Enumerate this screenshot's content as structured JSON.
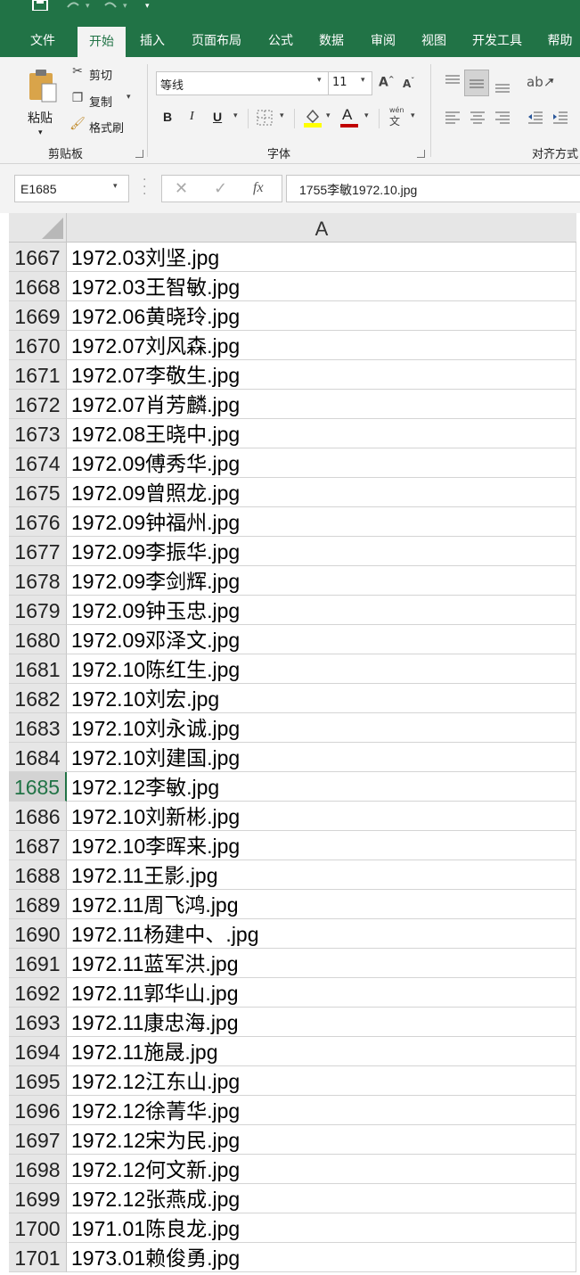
{
  "tabs": [
    "文件",
    "开始",
    "插入",
    "页面布局",
    "公式",
    "数据",
    "审阅",
    "视图",
    "开发工具",
    "帮助"
  ],
  "clipboard": {
    "paste": "粘贴",
    "cut": "剪切",
    "copy": "复制",
    "format_painter": "格式刷",
    "group_label": "剪贴板"
  },
  "font": {
    "name": "等线",
    "size": "11",
    "bold": "B",
    "italic": "I",
    "underline": "U",
    "group_label": "字体",
    "phonetic_top": "wén",
    "phonetic_bottom": "文"
  },
  "alignment": {
    "group_label": "对齐方式"
  },
  "name_box": "E1685",
  "formula": "1755李敏1972.10.jpg",
  "fx": "fx",
  "column_header": "A",
  "selected_row": "1685",
  "rows": [
    {
      "num": "1667",
      "value": "1972.03刘坚.jpg"
    },
    {
      "num": "1668",
      "value": "1972.03王智敏.jpg"
    },
    {
      "num": "1669",
      "value": "1972.06黄晓玲.jpg"
    },
    {
      "num": "1670",
      "value": "1972.07刘风森.jpg"
    },
    {
      "num": "1671",
      "value": "1972.07李敬生.jpg"
    },
    {
      "num": "1672",
      "value": "1972.07肖芳麟.jpg"
    },
    {
      "num": "1673",
      "value": "1972.08王晓中.jpg"
    },
    {
      "num": "1674",
      "value": "1972.09傅秀华.jpg"
    },
    {
      "num": "1675",
      "value": "1972.09曾照龙.jpg"
    },
    {
      "num": "1676",
      "value": "1972.09钟福州.jpg"
    },
    {
      "num": "1677",
      "value": "1972.09李振华.jpg"
    },
    {
      "num": "1678",
      "value": "1972.09李剑辉.jpg"
    },
    {
      "num": "1679",
      "value": "1972.09钟玉忠.jpg"
    },
    {
      "num": "1680",
      "value": "1972.09邓泽文.jpg"
    },
    {
      "num": "1681",
      "value": "1972.10陈红生.jpg"
    },
    {
      "num": "1682",
      "value": "1972.10刘宏.jpg"
    },
    {
      "num": "1683",
      "value": "1972.10刘永诚.jpg"
    },
    {
      "num": "1684",
      "value": "1972.10刘建国.jpg"
    },
    {
      "num": "1685",
      "value": "1972.12李敏.jpg"
    },
    {
      "num": "1686",
      "value": "1972.10刘新彬.jpg"
    },
    {
      "num": "1687",
      "value": "1972.10李晖来.jpg"
    },
    {
      "num": "1688",
      "value": "1972.11王影.jpg"
    },
    {
      "num": "1689",
      "value": "1972.11周飞鸿.jpg"
    },
    {
      "num": "1690",
      "value": "1972.11杨建中、.jpg"
    },
    {
      "num": "1691",
      "value": "1972.11蓝军洪.jpg"
    },
    {
      "num": "1692",
      "value": "1972.11郭华山.jpg"
    },
    {
      "num": "1693",
      "value": "1972.11康忠海.jpg"
    },
    {
      "num": "1694",
      "value": "1972.11施晟.jpg"
    },
    {
      "num": "1695",
      "value": "1972.12江东山.jpg"
    },
    {
      "num": "1696",
      "value": "1972.12徐菁华.jpg"
    },
    {
      "num": "1697",
      "value": "1972.12宋为民.jpg"
    },
    {
      "num": "1698",
      "value": "1972.12何文新.jpg"
    },
    {
      "num": "1699",
      "value": "1972.12张燕成.jpg"
    },
    {
      "num": "1700",
      "value": "1971.01陈良龙.jpg"
    },
    {
      "num": "1701",
      "value": "1973.01赖俊勇.jpg"
    }
  ],
  "colors": {
    "excel_green": "#217346",
    "ribbon_bg": "#f3f3f3",
    "header_bg": "#e6e6e6",
    "font_color_red": "#c00000",
    "highlight_yellow": "#ffff00"
  }
}
